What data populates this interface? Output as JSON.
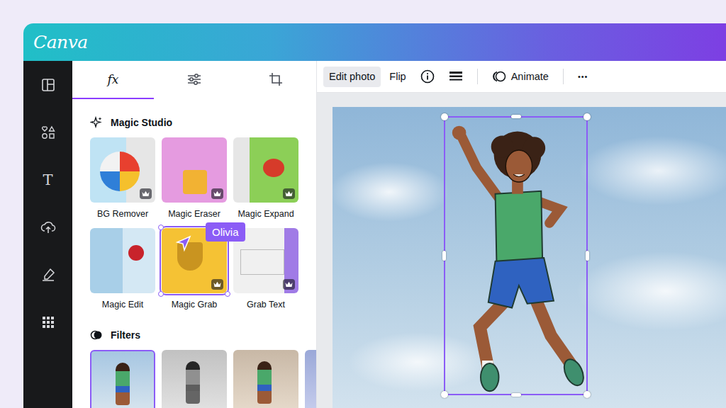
{
  "app": {
    "logo": "Canva"
  },
  "sidebar": {
    "items": [
      {
        "kind": "design"
      },
      {
        "kind": "elements"
      },
      {
        "kind": "text",
        "label": "T"
      },
      {
        "kind": "uploads"
      },
      {
        "kind": "draw"
      },
      {
        "kind": "apps"
      }
    ]
  },
  "panel": {
    "tabs": [
      {
        "kind": "effects",
        "label": "fx",
        "selected": true
      },
      {
        "kind": "adjust",
        "selected": false
      },
      {
        "kind": "crop",
        "selected": false
      }
    ]
  },
  "magic_studio": {
    "title": "Magic Studio",
    "tools": [
      {
        "label": "BG Remover",
        "premium": true,
        "selected": false
      },
      {
        "label": "Magic Eraser",
        "premium": true,
        "selected": false
      },
      {
        "label": "Magic Expand",
        "premium": true,
        "selected": false
      },
      {
        "label": "Magic Edit",
        "premium": false,
        "selected": false
      },
      {
        "label": "Magic Grab",
        "premium": true,
        "selected": true,
        "cursor": "Olivia"
      },
      {
        "label": "Grab Text",
        "premium": true,
        "selected": false
      }
    ]
  },
  "filters": {
    "title": "Filters",
    "items": [
      {
        "kind": "original",
        "selected": true
      },
      {
        "kind": "mono",
        "selected": false
      },
      {
        "kind": "warm",
        "selected": false
      },
      {
        "kind": "cool",
        "selected": false
      }
    ]
  },
  "toolbar": {
    "items": [
      {
        "kind": "button",
        "label": "Edit photo",
        "selected": true
      },
      {
        "kind": "button",
        "label": "Flip",
        "selected": false
      },
      {
        "kind": "info",
        "selected": false
      },
      {
        "kind": "position",
        "selected": false
      },
      {
        "kind": "animate",
        "label": "Animate",
        "selected": false
      },
      {
        "kind": "more",
        "label": "•••",
        "selected": false
      }
    ]
  },
  "canvas": {
    "element": {
      "selected": true
    }
  }
}
